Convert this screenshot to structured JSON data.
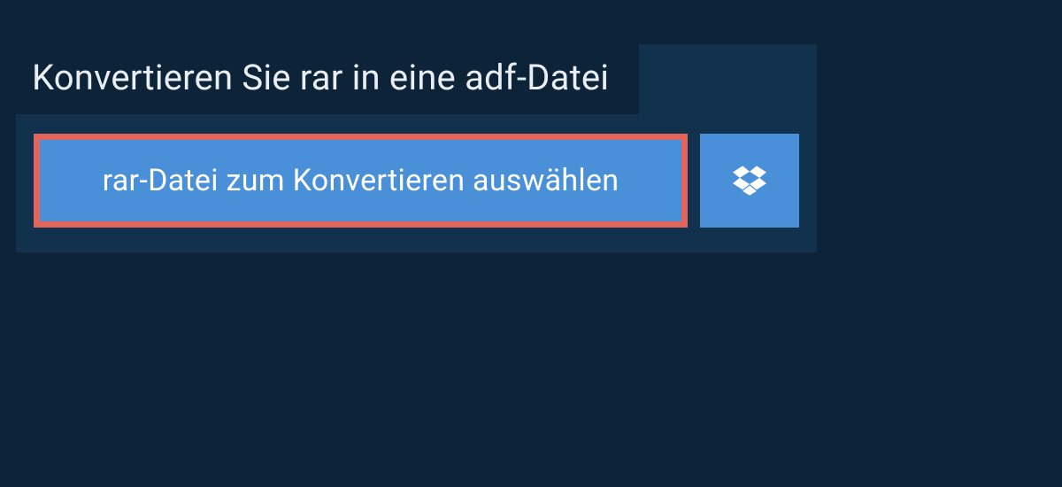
{
  "heading": "Konvertieren Sie rar in eine adf-Datei",
  "select_button_label": "rar-Datei zum Konvertieren auswählen",
  "colors": {
    "background": "#0d2438",
    "panel": "#11314d",
    "button": "#4a90d9",
    "highlight_border": "#e2645a",
    "text": "#ffffff"
  }
}
